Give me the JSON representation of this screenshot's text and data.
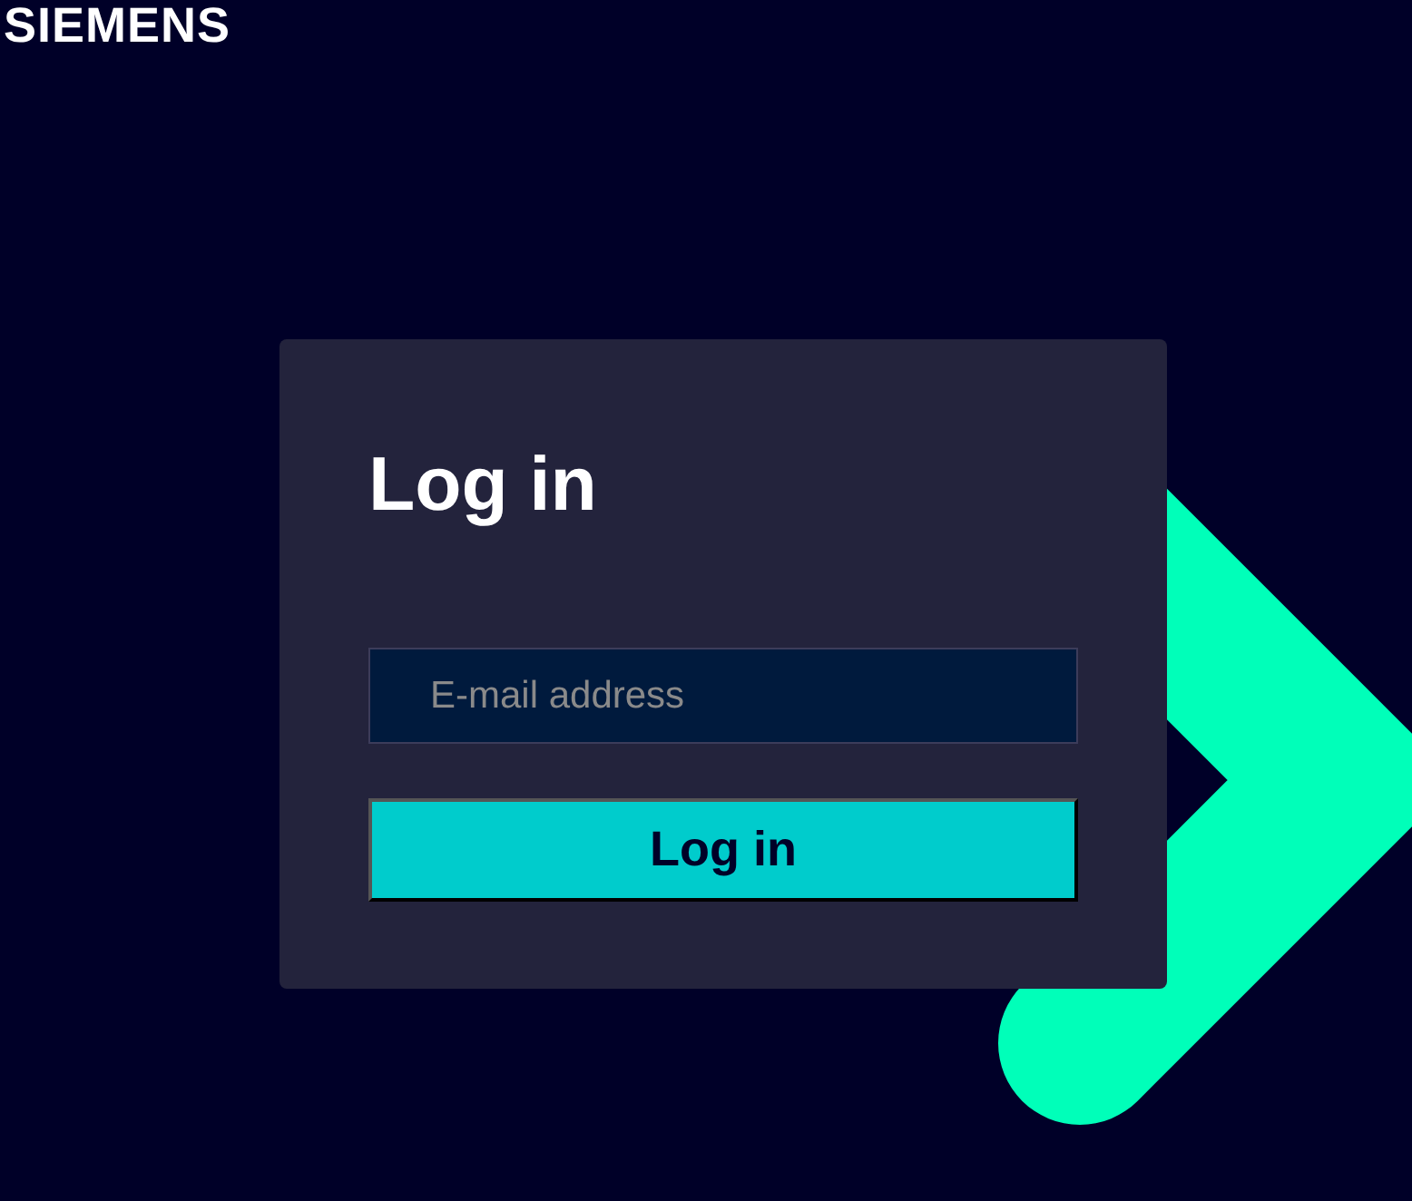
{
  "logo": {
    "text": "SIEMENS"
  },
  "login_card": {
    "title": "Log in",
    "email_field": {
      "placeholder": "E-mail address"
    },
    "submit_button": {
      "label": "Log in"
    }
  }
}
